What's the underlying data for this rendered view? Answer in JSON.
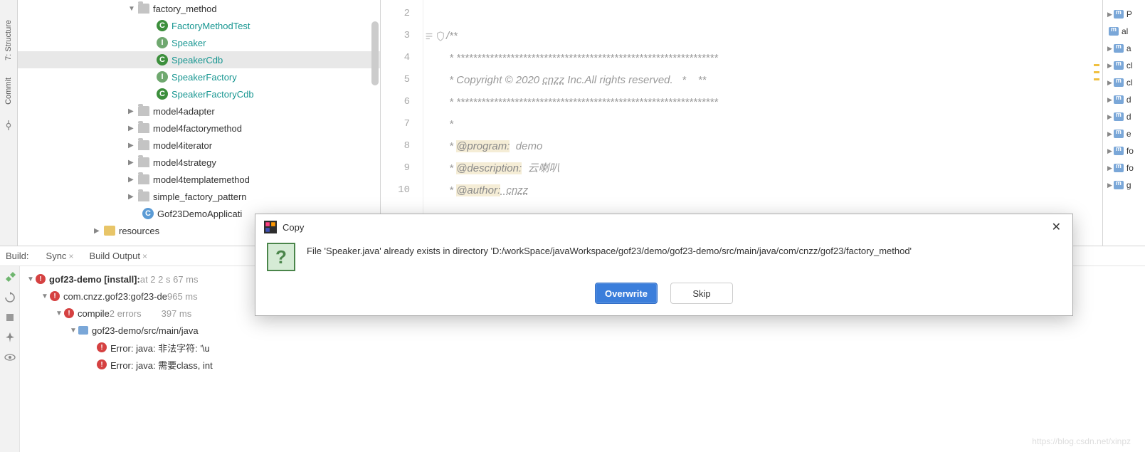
{
  "leftToolbar": {
    "structure": "7: Structure",
    "commit": "Commit"
  },
  "tree": {
    "factory_method": "factory_method",
    "FactoryMethodTest": "FactoryMethodTest",
    "Speaker": "Speaker",
    "SpeakerCdb": "SpeakerCdb",
    "SpeakerFactory": "SpeakerFactory",
    "SpeakerFactoryCdb": "SpeakerFactoryCdb",
    "model4adapter": "model4adapter",
    "model4factorymethod": "model4factorymethod",
    "model4iterator": "model4iterator",
    "model4strategy": "model4strategy",
    "model4templatemethod": "model4templatemethod",
    "simple_factory_pattern": "simple_factory_pattern",
    "Gof23DemoApplicati": "Gof23DemoApplicati",
    "resources": "resources"
  },
  "editor": {
    "lines": {
      "2": "",
      "3": "/**",
      "4": " * ***************************************************************",
      "5_pre": " * Copyright © 2020 ",
      "5_u": "cnzz",
      "5_post": " Inc.All rights reserved.   *    **",
      "6": " * ***************************************************************",
      "7": " *",
      "8_pre": " * ",
      "8_tag": "@program:",
      "8_val": "  demo",
      "9_pre": " * ",
      "9_tag": "@description:",
      "9_val": "  云喇叭",
      "10_pre": " * ",
      "10_tag": "@author:",
      "10_val": "  cnzz"
    },
    "lineNumbers": [
      "2",
      "3",
      "4",
      "5",
      "6",
      "7",
      "8",
      "9",
      "10"
    ]
  },
  "rightPanel": {
    "items": [
      "P",
      "al",
      "a",
      "cl",
      "cl",
      "d",
      "d",
      "e",
      "fo",
      "fo",
      "g"
    ]
  },
  "build": {
    "label": "Build:",
    "tabSync": "Sync",
    "tabOutput": "Build Output",
    "row0_main": "gof23-demo [install]:",
    "row0_light": " at 2 2 s 67 ms",
    "row1_main": "com.cnzz.gof23:gof23-de",
    "row1_light": " 965 ms",
    "row2_main": "compile ",
    "row2_err": "2 errors",
    "row2_light": "397 ms",
    "row3_main": "gof23-demo/src/main/java",
    "row4_main": "Error: java: 非法字符: '\\u",
    "row5_main": "Error: java: 需要class, int"
  },
  "dialog": {
    "title": "Copy",
    "message": "File 'Speaker.java' already exists in directory 'D:/workSpace/javaWorkspace/gof23/demo/gof23-demo/src/main/java/com/cnzz/gof23/factory_method'",
    "overwrite": "Overwrite",
    "skip": "Skip"
  },
  "watermark": "https://blog.csdn.net/xinpz"
}
